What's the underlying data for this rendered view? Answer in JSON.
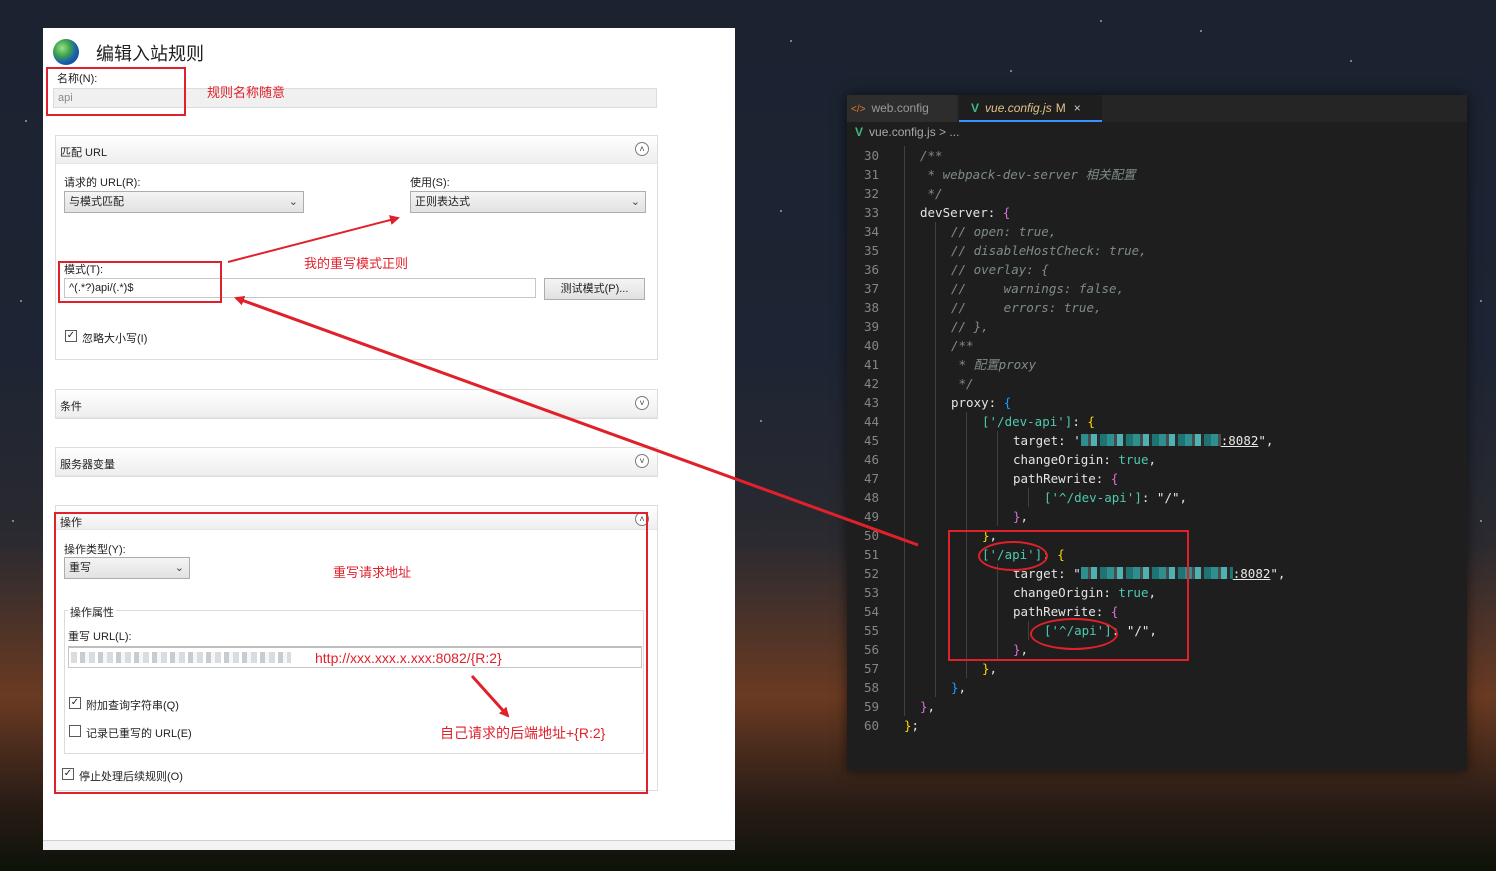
{
  "iis": {
    "title": "编辑入站规则",
    "name_label": "名称(N):",
    "name_value": "api",
    "match_url": {
      "title": "匹配 URL",
      "requested_url_label": "请求的 URL(R):",
      "requested_url_value": "与模式匹配",
      "using_label": "使用(S):",
      "using_value": "正则表达式",
      "pattern_label": "模式(T):",
      "pattern_value": "^(.*?)api/(.*)$",
      "test_button": "测试模式(P)...",
      "ignore_case_label": "忽略大小写(I)",
      "ignore_case_checked": true
    },
    "conditions": {
      "title": "条件"
    },
    "server_vars": {
      "title": "服务器变量"
    },
    "action": {
      "title": "操作",
      "type_label": "操作类型(Y):",
      "type_value": "重写",
      "props_title": "操作属性",
      "rewrite_url_label": "重写 URL(L):",
      "append_query_label": "附加查询字符串(Q)",
      "append_query_checked": true,
      "log_rewritten_label": "记录已重写的 URL(E)",
      "log_rewritten_checked": false,
      "stop_processing_label": "停止处理后续规则(O)",
      "stop_processing_checked": true
    }
  },
  "annotations": {
    "name_note": "规则名称随意",
    "pattern_note": "我的重写模式正则",
    "rewrite_note": "重写请求地址",
    "url_note": "http://xxx.xxx.x.xxx:8082/{R:2}",
    "backend_note": "自己请求的后端地址+{R:2}"
  },
  "vscode": {
    "tabs": [
      {
        "icon": "html-icon",
        "label": "web.config",
        "active": false
      },
      {
        "icon": "vue-icon",
        "label": "vue.config.js",
        "modified": "M",
        "close": "×",
        "active": true
      }
    ],
    "breadcrumb": "vue.config.js > ...",
    "lines": [
      {
        "n": "30",
        "text": "/**"
      },
      {
        "n": "31",
        "text": " * webpack-dev-server 相关配置"
      },
      {
        "n": "32",
        "text": " */"
      },
      {
        "n": "33",
        "text": "devServer: {"
      },
      {
        "n": "34",
        "text": "// open: true,"
      },
      {
        "n": "35",
        "text": "// disableHostCheck: true,"
      },
      {
        "n": "36",
        "text": "// overlay: {"
      },
      {
        "n": "37",
        "text": "//     warnings: false,"
      },
      {
        "n": "38",
        "text": "//     errors: true,"
      },
      {
        "n": "39",
        "text": "// },"
      },
      {
        "n": "40",
        "text": "/**"
      },
      {
        "n": "41",
        "text": " * 配置proxy"
      },
      {
        "n": "42",
        "text": " */"
      },
      {
        "n": "43",
        "text": "proxy: {"
      },
      {
        "n": "44",
        "text": "['/dev-api']: {"
      },
      {
        "n": "45",
        "text": "target: ':8082',"
      },
      {
        "n": "46",
        "text": "changeOrigin: true,"
      },
      {
        "n": "47",
        "text": "pathRewrite: {"
      },
      {
        "n": "48",
        "text": "['^/dev-api']: \"/\","
      },
      {
        "n": "49",
        "text": "},"
      },
      {
        "n": "50",
        "text": "},"
      },
      {
        "n": "51",
        "text": "['/api']: {"
      },
      {
        "n": "52",
        "text": "target: \":8082\","
      },
      {
        "n": "53",
        "text": "changeOrigin: true,"
      },
      {
        "n": "54",
        "text": "pathRewrite: {"
      },
      {
        "n": "55",
        "text": "['^/api']: \"/\","
      },
      {
        "n": "56",
        "text": "},"
      },
      {
        "n": "57",
        "text": "},"
      },
      {
        "n": "58",
        "text": "},"
      },
      {
        "n": "59",
        "text": "},"
      },
      {
        "n": "60",
        "text": "};"
      }
    ],
    "tokens": {
      "c31": " * webpack-dev-server 相关配置",
      "c41": " * 配置proxy",
      "devServer": "devServer",
      "proxy": "proxy",
      "dev_api_key": "'/dev-api'",
      "target": "target",
      "port_a": ":8082",
      "changeOrigin": "changeOrigin",
      "true": "true",
      "pathRewrite": "pathRewrite",
      "dev_api_rewrite": "'^/dev-api'",
      "slash": "\"/\"",
      "api_key": "'/api'",
      "port_b": ":8082",
      "api_rewrite": "'^/api'",
      "com34": "// open: true,",
      "com35": "// disableHostCheck: true,",
      "com36": "// overlay: {",
      "com37": "//     warnings: false,",
      "com38": "//     errors: true,",
      "com39": "// },"
    }
  },
  "colors": {
    "annotation_red": "#e0212b",
    "vscode_bg": "#1e1e1e",
    "comment": "#6a9955",
    "string": "#ce9178",
    "bool": "#569cd6"
  }
}
